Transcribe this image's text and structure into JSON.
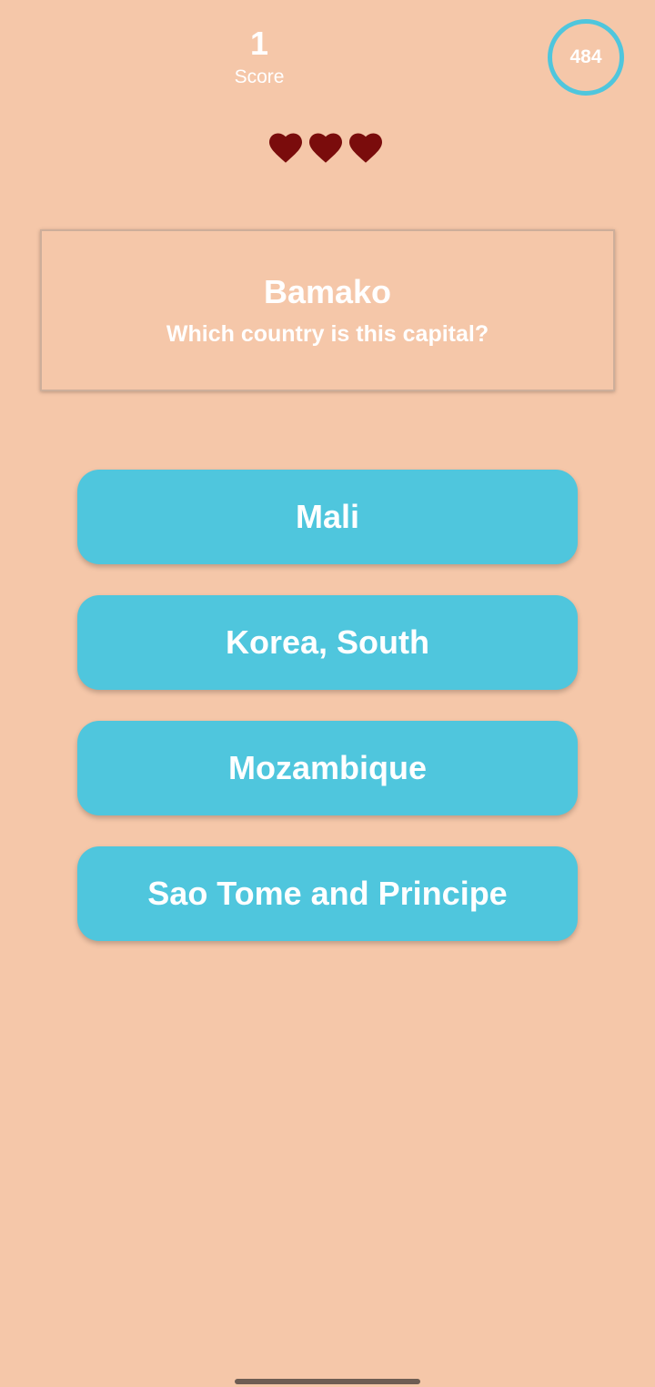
{
  "header": {
    "score_value": "1",
    "score_label": "Score",
    "timer_value": "484"
  },
  "lives": {
    "count": 3,
    "icon": "heart-icon",
    "color": "#7A0C0C"
  },
  "question": {
    "capital": "Bamako",
    "prompt": "Which country is this capital?"
  },
  "answers": [
    {
      "label": "Mali"
    },
    {
      "label": "Korea, South"
    },
    {
      "label": "Mozambique"
    },
    {
      "label": "Sao Tome and Principe"
    }
  ],
  "colors": {
    "background": "#F5C7A9",
    "accent": "#4FC6DD",
    "text": "#FFFFFF"
  }
}
